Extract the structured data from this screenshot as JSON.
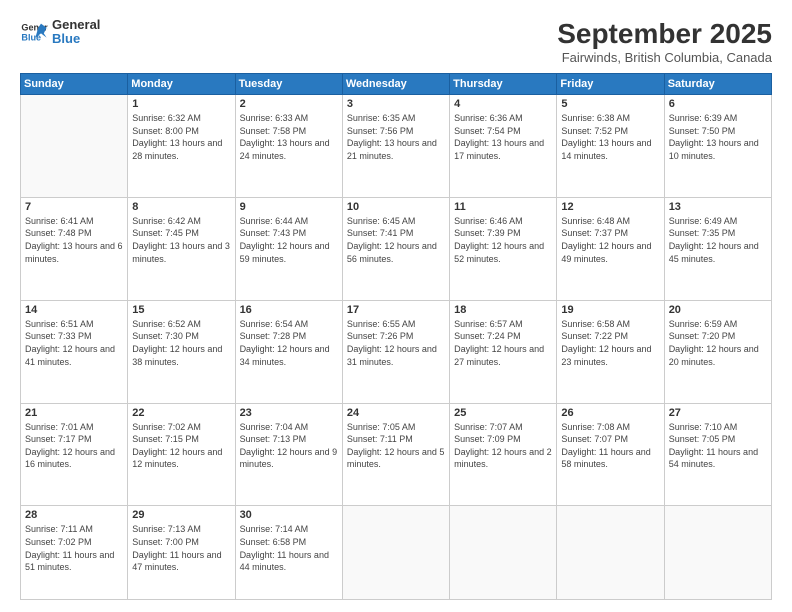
{
  "header": {
    "logo_line1": "General",
    "logo_line2": "Blue",
    "month": "September 2025",
    "location": "Fairwinds, British Columbia, Canada"
  },
  "weekdays": [
    "Sunday",
    "Monday",
    "Tuesday",
    "Wednesday",
    "Thursday",
    "Friday",
    "Saturday"
  ],
  "weeks": [
    [
      {
        "day": "",
        "sunrise": "",
        "sunset": "",
        "daylight": ""
      },
      {
        "day": "1",
        "sunrise": "Sunrise: 6:32 AM",
        "sunset": "Sunset: 8:00 PM",
        "daylight": "Daylight: 13 hours and 28 minutes."
      },
      {
        "day": "2",
        "sunrise": "Sunrise: 6:33 AM",
        "sunset": "Sunset: 7:58 PM",
        "daylight": "Daylight: 13 hours and 24 minutes."
      },
      {
        "day": "3",
        "sunrise": "Sunrise: 6:35 AM",
        "sunset": "Sunset: 7:56 PM",
        "daylight": "Daylight: 13 hours and 21 minutes."
      },
      {
        "day": "4",
        "sunrise": "Sunrise: 6:36 AM",
        "sunset": "Sunset: 7:54 PM",
        "daylight": "Daylight: 13 hours and 17 minutes."
      },
      {
        "day": "5",
        "sunrise": "Sunrise: 6:38 AM",
        "sunset": "Sunset: 7:52 PM",
        "daylight": "Daylight: 13 hours and 14 minutes."
      },
      {
        "day": "6",
        "sunrise": "Sunrise: 6:39 AM",
        "sunset": "Sunset: 7:50 PM",
        "daylight": "Daylight: 13 hours and 10 minutes."
      }
    ],
    [
      {
        "day": "7",
        "sunrise": "Sunrise: 6:41 AM",
        "sunset": "Sunset: 7:48 PM",
        "daylight": "Daylight: 13 hours and 6 minutes."
      },
      {
        "day": "8",
        "sunrise": "Sunrise: 6:42 AM",
        "sunset": "Sunset: 7:45 PM",
        "daylight": "Daylight: 13 hours and 3 minutes."
      },
      {
        "day": "9",
        "sunrise": "Sunrise: 6:44 AM",
        "sunset": "Sunset: 7:43 PM",
        "daylight": "Daylight: 12 hours and 59 minutes."
      },
      {
        "day": "10",
        "sunrise": "Sunrise: 6:45 AM",
        "sunset": "Sunset: 7:41 PM",
        "daylight": "Daylight: 12 hours and 56 minutes."
      },
      {
        "day": "11",
        "sunrise": "Sunrise: 6:46 AM",
        "sunset": "Sunset: 7:39 PM",
        "daylight": "Daylight: 12 hours and 52 minutes."
      },
      {
        "day": "12",
        "sunrise": "Sunrise: 6:48 AM",
        "sunset": "Sunset: 7:37 PM",
        "daylight": "Daylight: 12 hours and 49 minutes."
      },
      {
        "day": "13",
        "sunrise": "Sunrise: 6:49 AM",
        "sunset": "Sunset: 7:35 PM",
        "daylight": "Daylight: 12 hours and 45 minutes."
      }
    ],
    [
      {
        "day": "14",
        "sunrise": "Sunrise: 6:51 AM",
        "sunset": "Sunset: 7:33 PM",
        "daylight": "Daylight: 12 hours and 41 minutes."
      },
      {
        "day": "15",
        "sunrise": "Sunrise: 6:52 AM",
        "sunset": "Sunset: 7:30 PM",
        "daylight": "Daylight: 12 hours and 38 minutes."
      },
      {
        "day": "16",
        "sunrise": "Sunrise: 6:54 AM",
        "sunset": "Sunset: 7:28 PM",
        "daylight": "Daylight: 12 hours and 34 minutes."
      },
      {
        "day": "17",
        "sunrise": "Sunrise: 6:55 AM",
        "sunset": "Sunset: 7:26 PM",
        "daylight": "Daylight: 12 hours and 31 minutes."
      },
      {
        "day": "18",
        "sunrise": "Sunrise: 6:57 AM",
        "sunset": "Sunset: 7:24 PM",
        "daylight": "Daylight: 12 hours and 27 minutes."
      },
      {
        "day": "19",
        "sunrise": "Sunrise: 6:58 AM",
        "sunset": "Sunset: 7:22 PM",
        "daylight": "Daylight: 12 hours and 23 minutes."
      },
      {
        "day": "20",
        "sunrise": "Sunrise: 6:59 AM",
        "sunset": "Sunset: 7:20 PM",
        "daylight": "Daylight: 12 hours and 20 minutes."
      }
    ],
    [
      {
        "day": "21",
        "sunrise": "Sunrise: 7:01 AM",
        "sunset": "Sunset: 7:17 PM",
        "daylight": "Daylight: 12 hours and 16 minutes."
      },
      {
        "day": "22",
        "sunrise": "Sunrise: 7:02 AM",
        "sunset": "Sunset: 7:15 PM",
        "daylight": "Daylight: 12 hours and 12 minutes."
      },
      {
        "day": "23",
        "sunrise": "Sunrise: 7:04 AM",
        "sunset": "Sunset: 7:13 PM",
        "daylight": "Daylight: 12 hours and 9 minutes."
      },
      {
        "day": "24",
        "sunrise": "Sunrise: 7:05 AM",
        "sunset": "Sunset: 7:11 PM",
        "daylight": "Daylight: 12 hours and 5 minutes."
      },
      {
        "day": "25",
        "sunrise": "Sunrise: 7:07 AM",
        "sunset": "Sunset: 7:09 PM",
        "daylight": "Daylight: 12 hours and 2 minutes."
      },
      {
        "day": "26",
        "sunrise": "Sunrise: 7:08 AM",
        "sunset": "Sunset: 7:07 PM",
        "daylight": "Daylight: 11 hours and 58 minutes."
      },
      {
        "day": "27",
        "sunrise": "Sunrise: 7:10 AM",
        "sunset": "Sunset: 7:05 PM",
        "daylight": "Daylight: 11 hours and 54 minutes."
      }
    ],
    [
      {
        "day": "28",
        "sunrise": "Sunrise: 7:11 AM",
        "sunset": "Sunset: 7:02 PM",
        "daylight": "Daylight: 11 hours and 51 minutes."
      },
      {
        "day": "29",
        "sunrise": "Sunrise: 7:13 AM",
        "sunset": "Sunset: 7:00 PM",
        "daylight": "Daylight: 11 hours and 47 minutes."
      },
      {
        "day": "30",
        "sunrise": "Sunrise: 7:14 AM",
        "sunset": "Sunset: 6:58 PM",
        "daylight": "Daylight: 11 hours and 44 minutes."
      },
      {
        "day": "",
        "sunrise": "",
        "sunset": "",
        "daylight": ""
      },
      {
        "day": "",
        "sunrise": "",
        "sunset": "",
        "daylight": ""
      },
      {
        "day": "",
        "sunrise": "",
        "sunset": "",
        "daylight": ""
      },
      {
        "day": "",
        "sunrise": "",
        "sunset": "",
        "daylight": ""
      }
    ]
  ]
}
